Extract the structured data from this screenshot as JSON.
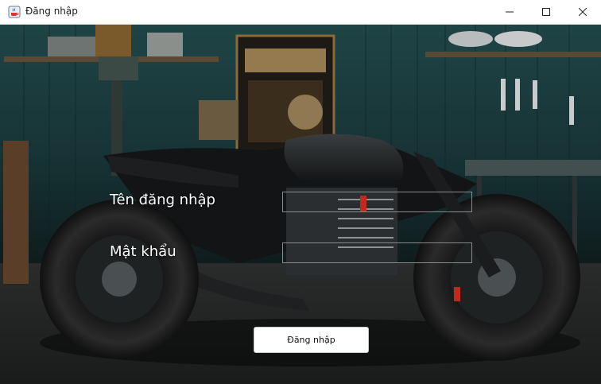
{
  "window": {
    "title": "Đăng nhập"
  },
  "form": {
    "username_label": "Tên đăng nhập",
    "username_value": "",
    "password_label": "Mật khẩu",
    "password_value": "",
    "login_button_label": "Đăng nhập"
  },
  "icons": {
    "app": "java-coffee-cup-icon",
    "minimize": "minimize-icon",
    "maximize": "maximize-icon",
    "close": "close-icon"
  },
  "colors": {
    "field_border": "#8b8b8b",
    "label_text": "#ffffff",
    "background_wall": "#1b3a3c"
  }
}
